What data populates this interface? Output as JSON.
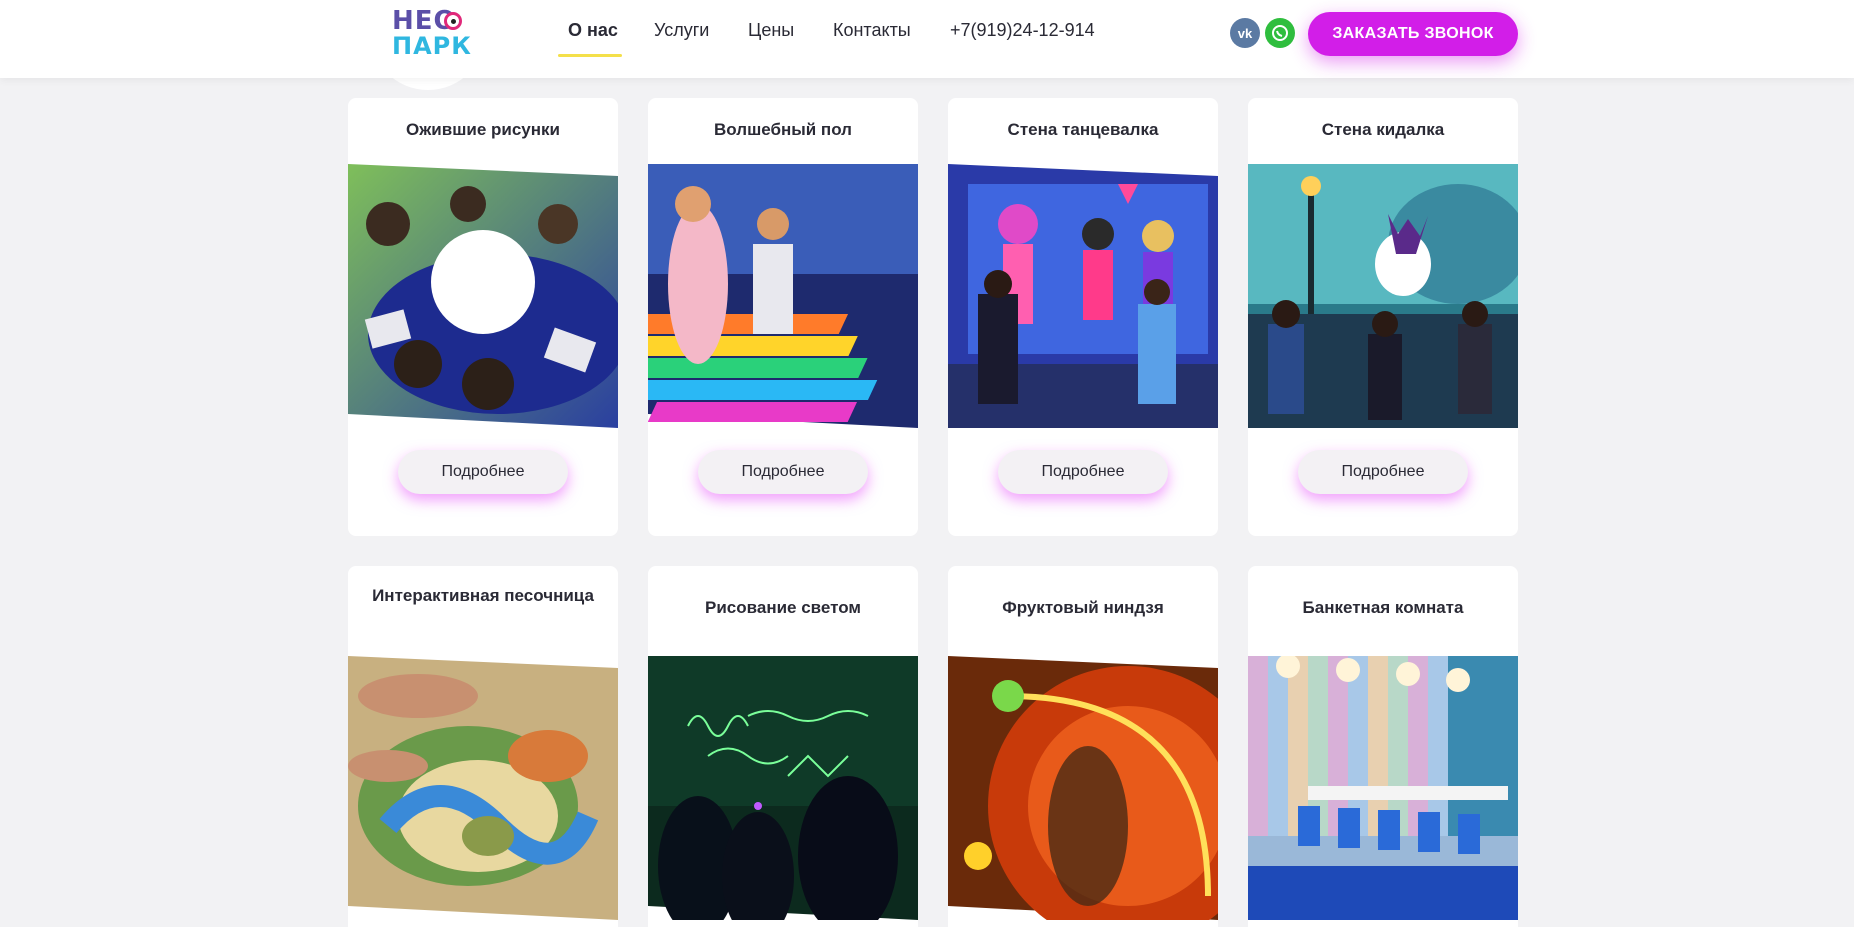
{
  "header": {
    "logo": {
      "line1": "НЕО",
      "line2": "ПАРК"
    },
    "nav": [
      {
        "label": "О нас",
        "active": true
      },
      {
        "label": "Услуги",
        "active": false
      },
      {
        "label": "Цены",
        "active": false
      },
      {
        "label": "Контакты",
        "active": false
      },
      {
        "label": "+7(919)24-12-914",
        "active": false
      }
    ],
    "social": [
      {
        "icon": "vk-icon",
        "text": "vk"
      },
      {
        "icon": "whatsapp-icon",
        "text": ""
      }
    ],
    "call_button": "ЗАКАЗАТЬ ЗВОНОК"
  },
  "cards": [
    {
      "title": "Ожившие рисунки",
      "button": "Подробнее",
      "image": "children-drawing-at-table"
    },
    {
      "title": "Волшебный пол",
      "button": "Подробнее",
      "image": "kids-on-interactive-floor"
    },
    {
      "title": "Стена танцевалка",
      "button": "Подробнее",
      "image": "kids-dancing-at-screen"
    },
    {
      "title": "Стена кидалка",
      "button": "Подробнее",
      "image": "kids-throwing-at-wall"
    },
    {
      "title": "Интерактивная песочница",
      "button": "",
      "image": "interactive-sandbox"
    },
    {
      "title": "Рисование светом",
      "button": "",
      "image": "light-drawing-wall"
    },
    {
      "title": "Фруктовый ниндзя",
      "button": "",
      "image": "fruit-ninja-game"
    },
    {
      "title": "Банкетная комната",
      "button": "",
      "image": "banquet-room"
    }
  ],
  "colors": {
    "accent": "#d21ee8",
    "nav_underline": "#f4e04a",
    "vk": "#5b7aa3",
    "whatsapp": "#2fbe3e",
    "background": "#f2f2f4"
  }
}
